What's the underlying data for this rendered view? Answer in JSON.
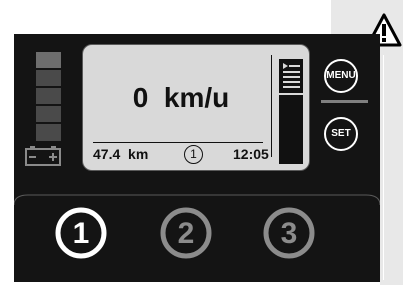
{
  "display": {
    "speed": "0  km/u",
    "odometer": "47.4  km",
    "trip_number": "1",
    "clock": "12:05"
  },
  "buttons": {
    "menu_label": "MENU",
    "set_label": "SET",
    "mode_buttons": [
      "1",
      "2",
      "3"
    ]
  },
  "colors": {
    "device": "#141414",
    "lcd": "#d9d9d9",
    "button_active": "#ffffff",
    "button_inactive": "#8c8c8c",
    "side_panel": "#e8e8e8"
  },
  "icons": {
    "warning": "warning-triangle-icon",
    "battery": "battery-icon",
    "fuel_gauge": "gauge-icon"
  }
}
